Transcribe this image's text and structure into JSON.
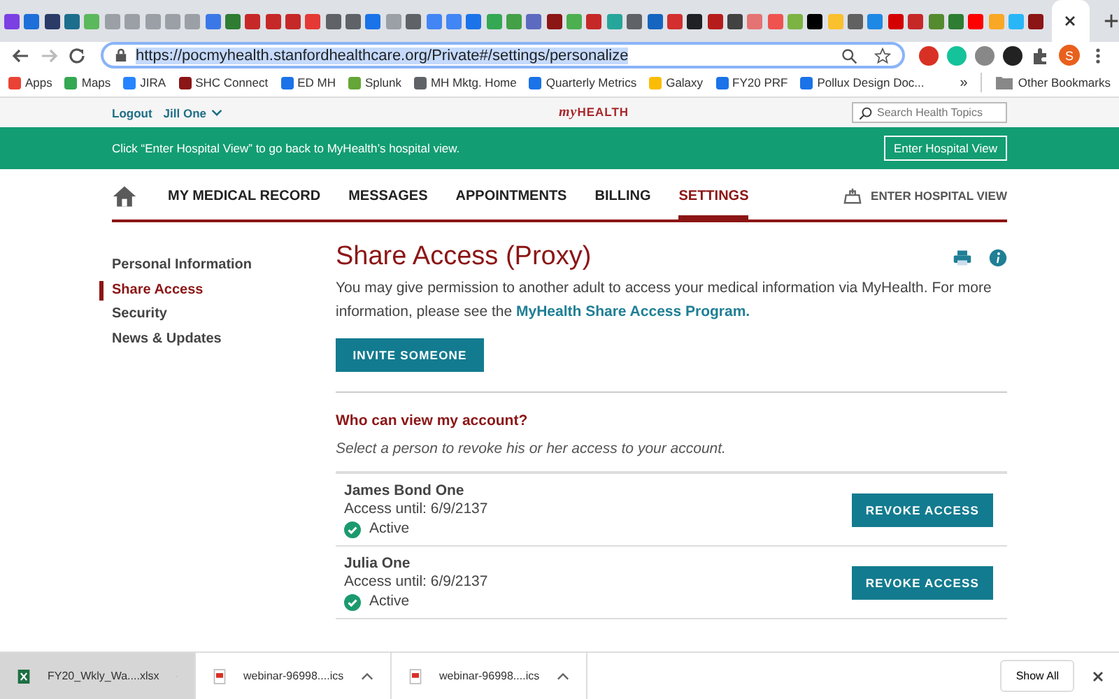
{
  "browser": {
    "tabs": [
      {
        "color": "#7b3fe4",
        "selected": false
      },
      {
        "color": "#1e6fd9",
        "selected": false
      },
      {
        "color": "#2b3a67",
        "selected": false
      },
      {
        "color": "#1c6e8c",
        "selected": false
      },
      {
        "color": "#5cb85c",
        "selected": false
      },
      {
        "color": "#9aa0a6",
        "selected": false
      },
      {
        "color": "#9aa0a6",
        "selected": false
      },
      {
        "color": "#9aa0a6",
        "selected": false
      },
      {
        "color": "#9aa0a6",
        "selected": false
      },
      {
        "color": "#9aa0a6",
        "selected": false
      },
      {
        "color": "#3b78e7",
        "selected": false
      },
      {
        "color": "#2e7d32",
        "selected": false
      },
      {
        "color": "#c62828",
        "selected": false
      },
      {
        "color": "#c62828",
        "selected": false
      },
      {
        "color": "#c62828",
        "selected": false
      },
      {
        "color": "#e53935",
        "selected": false
      },
      {
        "color": "#5f6368",
        "selected": false
      },
      {
        "color": "#5f6368",
        "selected": false
      },
      {
        "color": "#1a73e8",
        "selected": false
      },
      {
        "color": "#9aa0a6",
        "selected": false
      },
      {
        "color": "#5f6368",
        "selected": false
      },
      {
        "color": "#4285f4",
        "selected": false
      },
      {
        "color": "#4285f4",
        "selected": false
      },
      {
        "color": "#1a73e8",
        "selected": false
      },
      {
        "color": "#34a853",
        "selected": false
      },
      {
        "color": "#43a047",
        "selected": false
      },
      {
        "color": "#5c6bc0",
        "selected": false
      },
      {
        "color": "#8c1515",
        "selected": false
      },
      {
        "color": "#4caf50",
        "selected": false
      },
      {
        "color": "#c62828",
        "selected": false
      },
      {
        "color": "#26a69a",
        "selected": false
      },
      {
        "color": "#5f6368",
        "selected": false
      },
      {
        "color": "#1565c0",
        "selected": false
      },
      {
        "color": "#d32f2f",
        "selected": false
      },
      {
        "color": "#202124",
        "selected": false
      },
      {
        "color": "#b71c1c",
        "selected": false
      },
      {
        "color": "#424242",
        "selected": false
      },
      {
        "color": "#e57373",
        "selected": false
      },
      {
        "color": "#ef5350",
        "selected": false
      },
      {
        "color": "#7cb342",
        "selected": false
      },
      {
        "color": "#000000",
        "selected": false
      },
      {
        "color": "#fbc02d",
        "selected": false
      },
      {
        "color": "#616161",
        "selected": false
      },
      {
        "color": "#1e88e5",
        "selected": false
      },
      {
        "color": "#d50000",
        "selected": false
      },
      {
        "color": "#c62828",
        "selected": false
      },
      {
        "color": "#558b2f",
        "selected": false
      },
      {
        "color": "#2e7d32",
        "selected": false
      },
      {
        "color": "#ff0000",
        "selected": false
      },
      {
        "color": "#f9a825",
        "selected": false
      },
      {
        "color": "#29b6f6",
        "selected": false
      },
      {
        "color": "#8c1515",
        "selected": false
      },
      {
        "selected": true
      }
    ],
    "url": "https://pocmyhealth.stanfordhealthcare.org/Private#/settings/personalize",
    "bookmarks": [
      {
        "label": "Apps",
        "color": "#ea4335"
      },
      {
        "label": "Maps",
        "color": "#34a853"
      },
      {
        "label": "JIRA",
        "color": "#2684ff"
      },
      {
        "label": "SHC Connect",
        "color": "#8c1515"
      },
      {
        "label": "ED MH",
        "color": "#1a73e8"
      },
      {
        "label": "Splunk",
        "color": "#65a637"
      },
      {
        "label": "MH Mktg. Home",
        "color": "#5f6368"
      },
      {
        "label": "Quarterly Metrics",
        "color": "#1a73e8"
      },
      {
        "label": "Galaxy",
        "color": "#fbbc04"
      },
      {
        "label": "FY20 PRF",
        "color": "#1a73e8"
      },
      {
        "label": "Pollux Design Doc...",
        "color": "#1a73e8"
      }
    ],
    "more": "»",
    "other_bookmarks": "Other Bookmarks",
    "profile_initial": "S"
  },
  "site": {
    "logout": "Logout",
    "user": "Jill One",
    "logo_my": "my",
    "logo_health": "HEALTH",
    "search_placeholder": "Search Health Topics",
    "banner_text": "Click “Enter Hospital View” to go back to MyHealth’s hospital view.",
    "banner_button": "Enter Hospital View",
    "nav": [
      {
        "label": "MY MEDICAL RECORD",
        "selected": false
      },
      {
        "label": "MESSAGES",
        "selected": false
      },
      {
        "label": "APPOINTMENTS",
        "selected": false
      },
      {
        "label": "BILLING",
        "selected": false
      },
      {
        "label": "SETTINGS",
        "selected": true
      }
    ],
    "hospital_view": "ENTER HOSPITAL VIEW",
    "sidebar": [
      {
        "label": "Personal Information",
        "selected": false
      },
      {
        "label": "Share Access",
        "selected": true
      },
      {
        "label": "Security",
        "selected": false
      },
      {
        "label": "News & Updates",
        "selected": false
      }
    ],
    "title": "Share Access (Proxy)",
    "intro": "You may give permission to another adult to access your medical information via MyHealth. For more information, please see the ",
    "intro_link": "MyHealth Share Access Program.",
    "invite_button": "INVITE SOMEONE",
    "section_heading": "Who can view my account?",
    "section_hint": "Select a person to revoke his or her access to your account.",
    "proxies": [
      {
        "name": "James Bond One",
        "access": "Access until: 6/9/2137",
        "status": "Active",
        "button": "REVOKE ACCESS"
      },
      {
        "name": "Julia One",
        "access": "Access until: 6/9/2137",
        "status": "Active",
        "button": "REVOKE ACCESS"
      }
    ]
  },
  "downloads": {
    "items": [
      {
        "name": "FY20_Wkly_Wa....xlsx",
        "kind": "xlsx",
        "selected": true
      },
      {
        "name": "webinar-96998....ics",
        "kind": "ics",
        "selected": false
      },
      {
        "name": "webinar-96998....ics",
        "kind": "ics",
        "selected": false
      }
    ],
    "show_all": "Show All"
  }
}
